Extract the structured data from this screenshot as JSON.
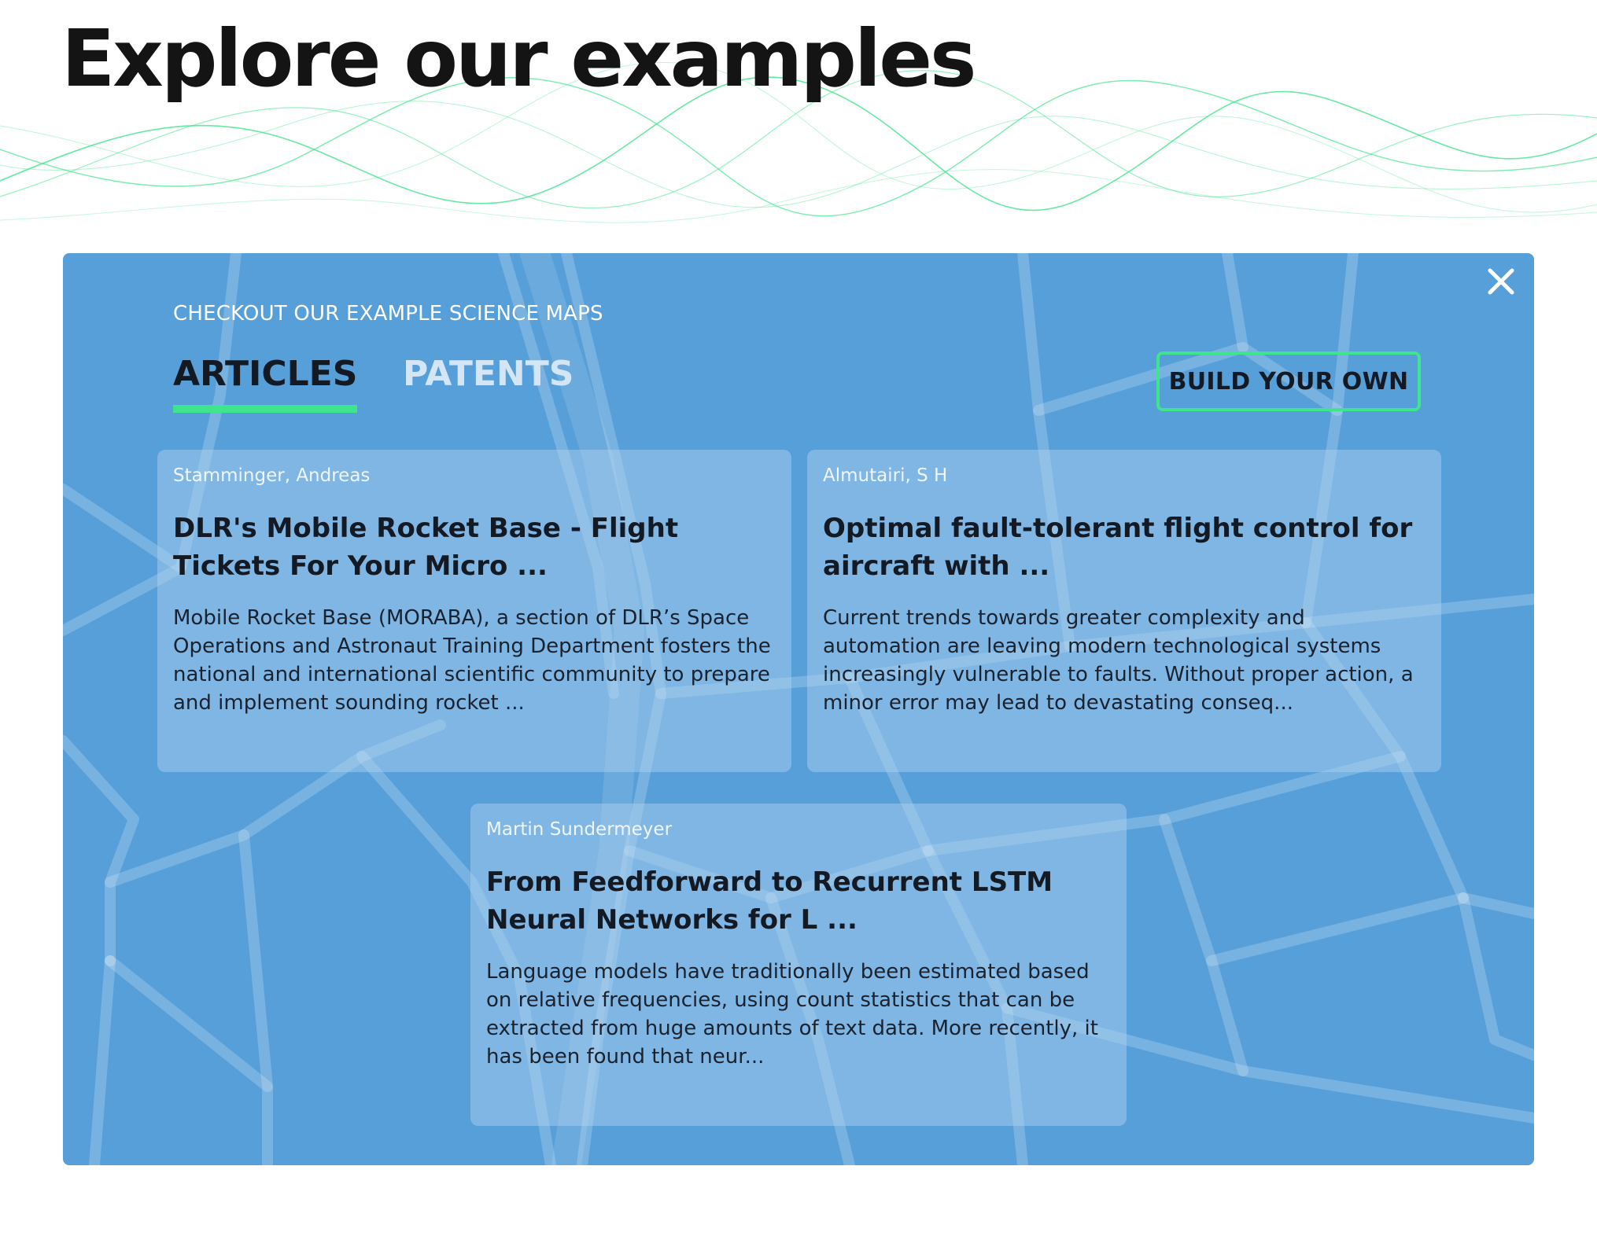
{
  "page": {
    "title": "Explore our examples"
  },
  "panel": {
    "eyebrow": "CHECKOUT OUR EXAMPLE SCIENCE MAPS",
    "tabs": [
      {
        "label": "ARTICLES",
        "active": true
      },
      {
        "label": "PATENTS",
        "active": false
      }
    ],
    "build_button_label": "BUILD YOUR OWN",
    "close_icon": "close-icon"
  },
  "cards": [
    {
      "author": "Stamminger, Andreas",
      "title": "DLR's Mobile Rocket Base - Flight Tickets For Your Micro ...",
      "abstract": "Mobile Rocket Base (MORABA), a section of DLR’s Space Operations and Astronaut Training Department fosters the national and international scientific community to prepare and implement sounding rocket ..."
    },
    {
      "author": "Almutairi, S H",
      "title": "Optimal fault-tolerant flight control for aircraft with ...",
      "abstract": "Current trends towards greater complexity and automation are leaving modern technological systems increasingly vulnerable to faults. Without proper action, a minor error may lead to devastating conseq..."
    },
    {
      "author": "Martin Sundermeyer",
      "title": "From Feedforward to Recurrent LSTM Neural Networks for L ...",
      "abstract": "Language models have traditionally been estimated based on relative frequencies, using count statistics that can be extracted from huge amounts of text data. More recently, it has been found that neur..."
    }
  ],
  "colors": {
    "panel_bg": "#579fd9",
    "accent_green": "#3ee58c",
    "title_text": "#141414"
  }
}
